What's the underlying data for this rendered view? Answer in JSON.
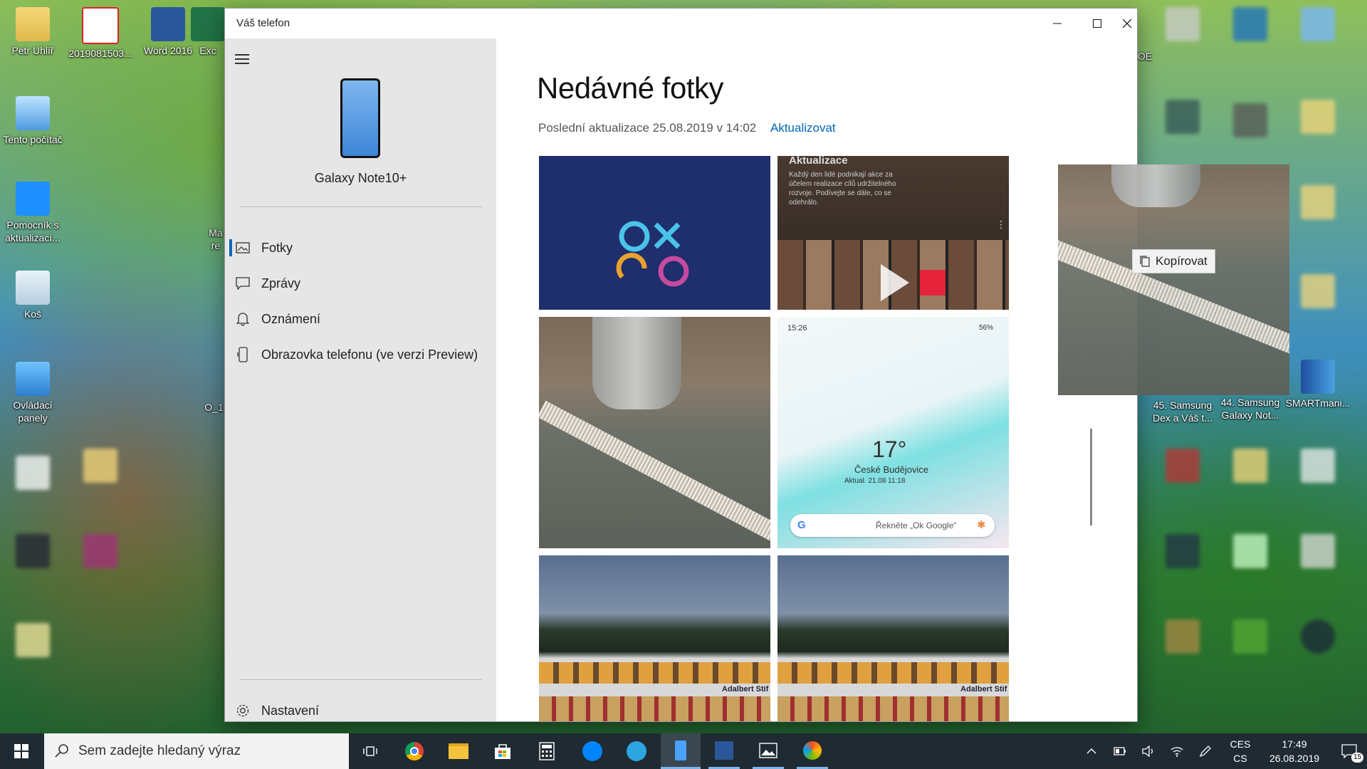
{
  "desktop": {
    "icons_left": [
      {
        "label": "Petr Uhlíř"
      },
      {
        "label": "2019081503..."
      },
      {
        "label": "Word 2016"
      },
      {
        "label": "Exc"
      },
      {
        "label": "Tento počítač"
      },
      {
        "label": "Pomocník s aktualizací..."
      },
      {
        "label": "Koš"
      },
      {
        "label": "Ovládací panely"
      },
      {
        "label": "Ma re"
      },
      {
        "label": "O_1"
      }
    ],
    "icons_right": [
      {
        "label": "45. Samsung Dex a Váš t..."
      },
      {
        "label": "44. Samsung Galaxy Not..."
      },
      {
        "label": "SMARTmani..."
      },
      {
        "label": "OE"
      }
    ]
  },
  "window": {
    "title": "Váš telefon",
    "device_name": "Galaxy Note10+",
    "nav": [
      {
        "label": "Fotky",
        "icon": "photos-icon",
        "active": true
      },
      {
        "label": "Zprávy",
        "icon": "message-icon",
        "active": false
      },
      {
        "label": "Oznámení",
        "icon": "bell-icon",
        "active": false
      },
      {
        "label": "Obrazovka telefonu (ve verzi Preview)",
        "icon": "phone-screen-icon",
        "active": false
      }
    ],
    "settings_label": "Nastavení",
    "main": {
      "title": "Nedávné fotky",
      "updated": "Poslední aktualizace 25.08.2019 v 14:02",
      "refresh": "Aktualizovat"
    },
    "photos": [
      {
        "name": "app-logo-photo"
      },
      {
        "name": "video-collage-photo",
        "text": "Aktualizace",
        "caption": "Každý den lidé podnikají akce za účelem realizace cílů udržitelného rozvoje. Podívejte se dále, co se odehrálo."
      },
      {
        "name": "vase-on-rug-photo"
      },
      {
        "name": "phone-screenshot-photo",
        "time": "15:26",
        "battery": "56%",
        "temp": "17°",
        "city": "České Budějovice",
        "updated": "Aktual. 21.08 11:18",
        "google_hint": "Řekněte „Ok Google“"
      },
      {
        "name": "boat-photo-1",
        "boat_name": "Adalbert Stif"
      },
      {
        "name": "boat-photo-2",
        "boat_name": "Adalbert Stif"
      }
    ],
    "drag_tooltip": "Kopírovat"
  },
  "taskbar": {
    "search_placeholder": "Sem zadejte hledaný výraz",
    "lang_top": "CES",
    "lang_bottom": "CS",
    "time": "17:49",
    "date": "26.08.2019",
    "notifications": "15"
  }
}
